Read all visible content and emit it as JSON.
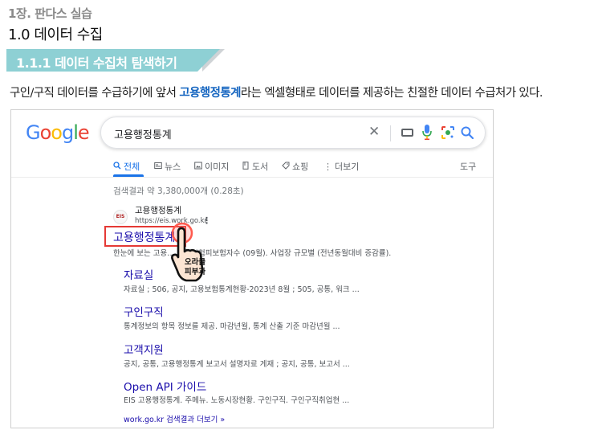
{
  "doc": {
    "chapter": "1장. 판다스 실습",
    "section": "1.0 데이터 수집",
    "banner": "1.1.1 데이터 수집처 탐색하기",
    "intro": {
      "before": "구인/구직 데이터를 수급하기에 앞서 ",
      "highlight": "고용행정통계",
      "after": "라는 엑셀형태로 데이터를 제공하는 친절한 데이터 수급처가 있다."
    }
  },
  "google": {
    "logo": {
      "g1": "G",
      "o1": "o",
      "o2": "o",
      "g2": "g",
      "l": "l",
      "e": "e"
    },
    "query": "고용행정통계",
    "tabs": [
      {
        "label": "전체",
        "icon": "search-icon"
      },
      {
        "label": "뉴스",
        "icon": "news-icon"
      },
      {
        "label": "이미지",
        "icon": "image-icon"
      },
      {
        "label": "도서",
        "icon": "book-icon"
      },
      {
        "label": "쇼핑",
        "icon": "tag-icon"
      },
      {
        "label": "더보기",
        "icon": "more-vert-icon"
      }
    ],
    "tools": "도구",
    "stats": "검색결과 약 3,380,000개 (0.28초)",
    "result": {
      "favicon_text": "EIS",
      "site_name": "고용행정통계",
      "url": "https://eis.work.go.kr",
      "title": "고용행정통계",
      "snippet": "한눈에 보는 고용… 고용보험피보험자수 (09월). 사업장 규모별 (전년동월대비 증감률).",
      "sublinks": [
        {
          "title": "자료실",
          "snippet": "자료실 ; 506, 공지, 고용보험통계현황-2023년 8월 ; 505, 공통, 워크 ..."
        },
        {
          "title": "구인구직",
          "snippet": "통계정보의 항목 정보를 제공. 마감년월, 통계 산출 기준 마감년월 ..."
        },
        {
          "title": "고객지원",
          "snippet": "공지, 공통, 고용행정통계 보고서 설명자료 게재 ; 공지, 공통, 보고서 ..."
        },
        {
          "title": "Open API 가이드",
          "snippet": "EIS 고용행정통계. 주메뉴. 노동시장현황. 구인구직. 구인구직취업현 ..."
        }
      ],
      "more_domain": "work.go.kr",
      "more_label": "검색결과 더보기 »"
    },
    "pointer_label_1": "오라클",
    "pointer_label_2": "피부과"
  }
}
